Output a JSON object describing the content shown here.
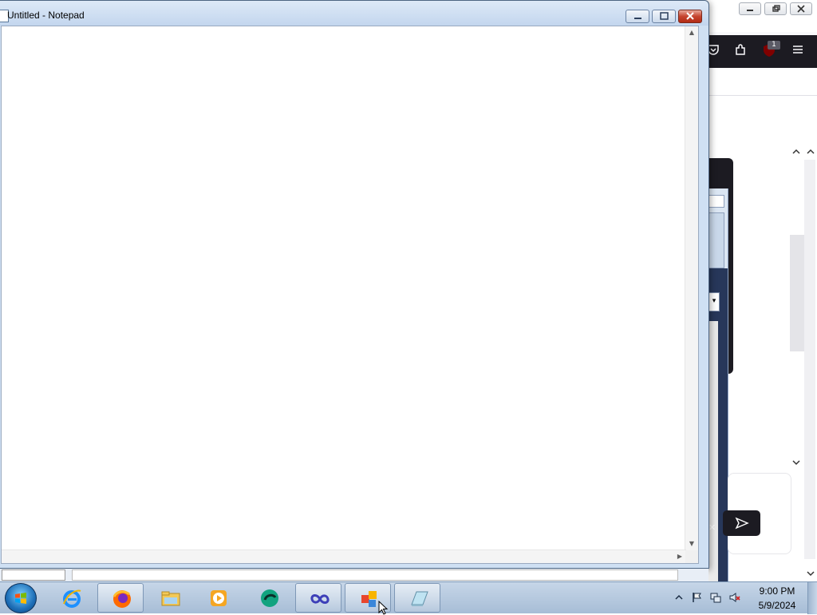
{
  "notepad": {
    "title": "Untitled - Notepad",
    "content": "",
    "controls": {
      "minimize": "",
      "maximize": "",
      "close": ""
    }
  },
  "browser": {
    "extension_badge_count": "1"
  },
  "taskbar": {
    "apps": [
      {
        "name": "internet-explorer",
        "running": false
      },
      {
        "name": "firefox",
        "running": true
      },
      {
        "name": "windows-explorer",
        "running": false
      },
      {
        "name": "media-player",
        "running": false
      },
      {
        "name": "app-green-bubble",
        "running": false
      },
      {
        "name": "app-infinity",
        "running": true
      },
      {
        "name": "app-colored-squares",
        "running": true
      },
      {
        "name": "notepad",
        "running": true
      }
    ],
    "clock": {
      "time": "9:00 PM",
      "date": "5/9/2024"
    }
  },
  "colors": {
    "taskbar": "#b9cbe0",
    "browser_toolbar": "#1c1b22",
    "notepad_frame": "#cfe0f3",
    "close_button": "#c64530"
  }
}
